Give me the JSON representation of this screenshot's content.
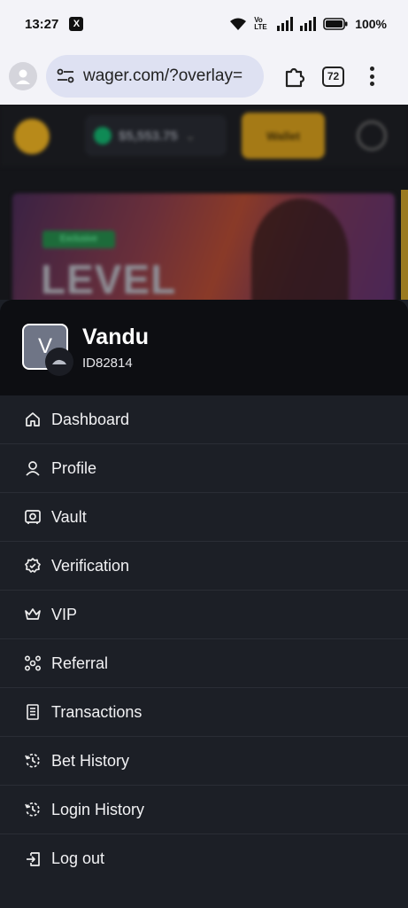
{
  "status_bar": {
    "time": "13:27",
    "battery": "100%",
    "network": "Vo LTE"
  },
  "browser": {
    "url": "wager.com/?overlay=",
    "tab_count": "72"
  },
  "background_site": {
    "balance": "$5,553.75",
    "wallet_label": "Wallet",
    "banner_badge": "Exclusive",
    "banner_title": "LEVEL"
  },
  "user": {
    "avatar_letter": "V",
    "name": "Vandu",
    "id": "ID82814"
  },
  "menu": [
    {
      "label": "Dashboard",
      "icon": "home-icon"
    },
    {
      "label": "Profile",
      "icon": "user-icon"
    },
    {
      "label": "Vault",
      "icon": "vault-icon"
    },
    {
      "label": "Verification",
      "icon": "verified-badge-icon"
    },
    {
      "label": "VIP",
      "icon": "crown-icon"
    },
    {
      "label": "Referral",
      "icon": "referral-icon"
    },
    {
      "label": "Transactions",
      "icon": "receipt-icon"
    },
    {
      "label": "Bet History",
      "icon": "history-icon"
    },
    {
      "label": "Login History",
      "icon": "history-icon"
    },
    {
      "label": "Log out",
      "icon": "logout-icon"
    }
  ],
  "colors": {
    "drawer_bg": "#1c1f26",
    "header_bg": "#0d0e12",
    "wallet_accent": "#a57a16",
    "browser_bar": "#f3f3f8"
  }
}
